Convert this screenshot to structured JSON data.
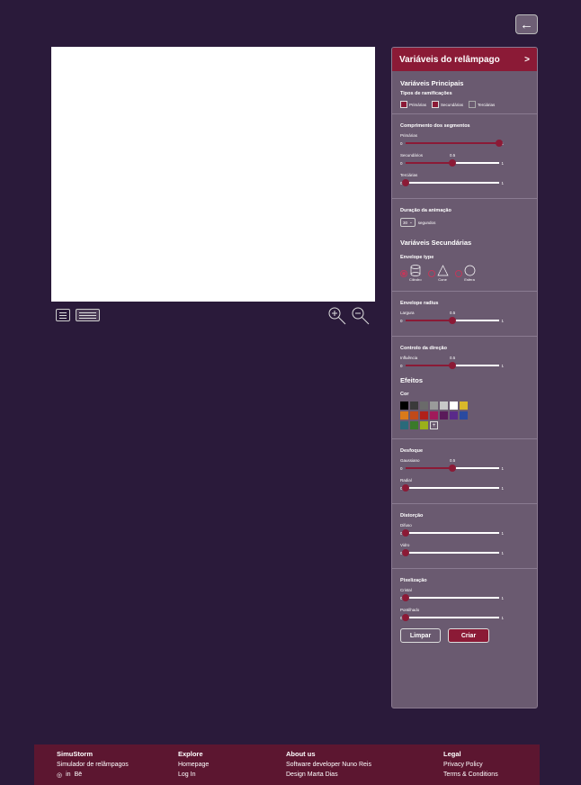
{
  "back_button": {
    "icon": "arrow-left-icon",
    "glyph": "←"
  },
  "panel": {
    "title": "Variáveis do relâmpago",
    "title_chevron": ">",
    "main_heading": "Variáveis Principais",
    "branch_types_label": "Tipos de ramificações",
    "branch_types": [
      {
        "label": "Primárias",
        "checked": true
      },
      {
        "label": "Secundárias",
        "checked": true
      },
      {
        "label": "Terciárias",
        "checked": false
      }
    ],
    "segments_label": "Comprimento dos segmentos",
    "segments": [
      {
        "label": "Primárias",
        "min": "0",
        "max": "1",
        "value": 1.0,
        "value_label": ""
      },
      {
        "label": "Secundários",
        "min": "0",
        "max": "1",
        "value": 0.5,
        "value_label": "0.5"
      },
      {
        "label": "Terciárias",
        "min": "0",
        "max": "1",
        "value": 0.0,
        "value_label": ""
      }
    ],
    "duration_label": "Duração da animação",
    "duration_value": "30",
    "duration_arrow": "⌄",
    "duration_unit": "segundos",
    "secondary_heading": "Variáveis Secundárias",
    "envelope_type_label": "Envelope type",
    "envelope_types": [
      {
        "label": "Cilindro",
        "selected": true
      },
      {
        "label": "Cone",
        "selected": false
      },
      {
        "label": "Esfera",
        "selected": false
      }
    ],
    "envelope_radius_label": "Envelope radius",
    "envelope_radius": {
      "label": "Largura",
      "min": "0",
      "max": "1",
      "value": 0.5,
      "value_label": "0.5"
    },
    "direction_label": "Controlo da direção",
    "direction": {
      "label": "Influência",
      "min": "0",
      "max": "1",
      "value": 0.5,
      "value_label": "0.5"
    },
    "effects_heading": "Efeitos",
    "color_label": "Cor",
    "colors": [
      "#000000",
      "#3a3a3a",
      "#6a6a6a",
      "#9a9a9a",
      "#c8c8c8",
      "#ffffff",
      "#d9b82a",
      "#d97a1a",
      "#c04a1a",
      "#b0201a",
      "#a01a5a",
      "#5a1a5a",
      "#5a2a8a",
      "#2a4aa0",
      "#2a6a7a",
      "#3a7a2a",
      "#9ab01a"
    ],
    "color_add": "+",
    "blur_label": "Desfoque",
    "blur": [
      {
        "label": "Gaussiano",
        "min": "0",
        "max": "1",
        "value": 0.5,
        "value_label": "0.5"
      },
      {
        "label": "Radial",
        "min": "0",
        "max": "1",
        "value": 0.0,
        "value_label": ""
      }
    ],
    "distortion_label": "Distorção",
    "distortion": [
      {
        "label": "Difuso",
        "min": "0",
        "max": "1",
        "value": 0.0,
        "value_label": ""
      },
      {
        "label": "Vidro",
        "min": "0",
        "max": "1",
        "value": 0.0,
        "value_label": ""
      }
    ],
    "pixel_label": "Pixelização",
    "pixel": [
      {
        "label": "Cristal",
        "min": "0",
        "max": "1",
        "value": 0.0,
        "value_label": ""
      },
      {
        "label": "Pontilhado",
        "min": "0",
        "max": "1",
        "value": 0.0,
        "value_label": ""
      }
    ],
    "clear_label": "Limpar",
    "create_label": "Criar"
  },
  "footer": {
    "brand": "SimuStorm",
    "brand_sub": "Simulador de relâmpagos",
    "social": [
      "◎",
      "in",
      "Bē"
    ],
    "explore_title": "Explore",
    "explore_links": [
      "Homepage",
      "Log In"
    ],
    "about_title": "About us",
    "about_links": [
      "Software developer Nuno Reis",
      "Design Marta Dias"
    ],
    "legal_title": "Legal",
    "legal_links": [
      "Privacy Policy",
      "Terms & Conditions"
    ]
  },
  "accent_color": "#8b1a36",
  "background_color": "#2a1a3a"
}
